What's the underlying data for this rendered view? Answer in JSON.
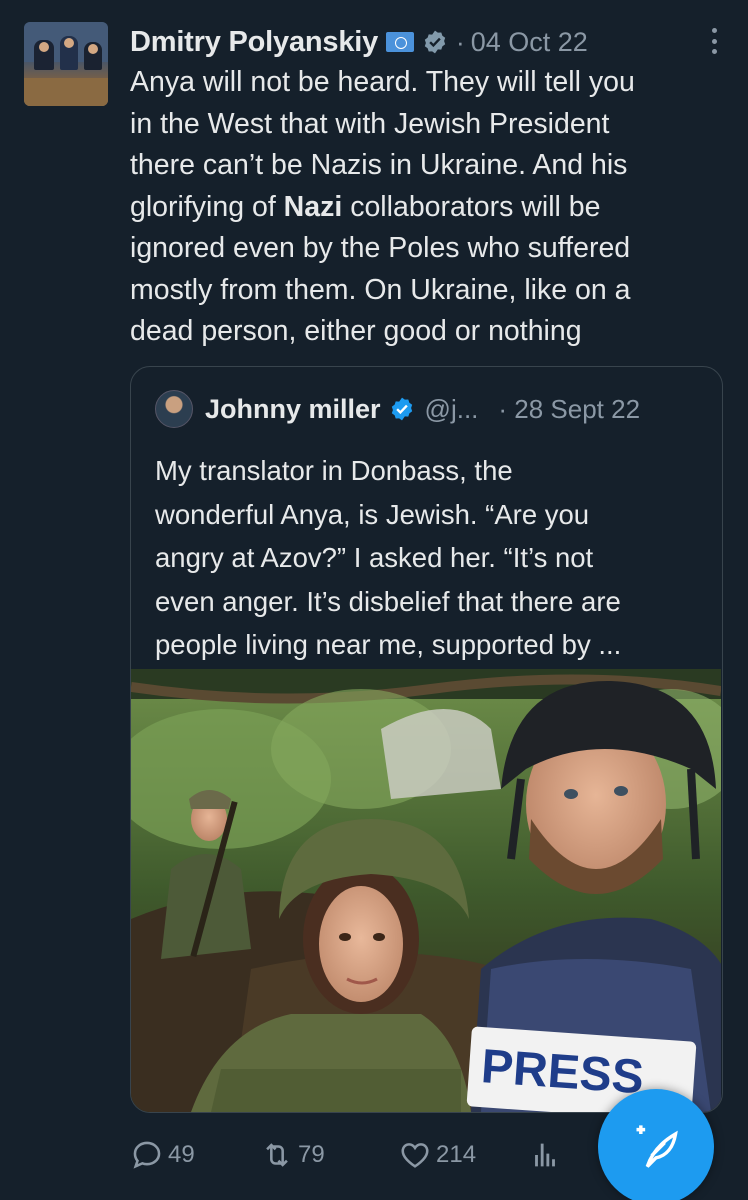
{
  "post": {
    "author_name": "Dmitry Polyanskiy",
    "date": "04 Oct 22",
    "separator": "·",
    "text_lines": [
      "Anya will not be heard. They will tell you",
      "in the West that with Jewish President",
      "there can’t be Nazis in Ukraine. And his",
      {
        "before": "glorifying of ",
        "bold": "Nazi",
        "after": " collaborators will be"
      },
      "ignored even by the Poles who suffered",
      "mostly from them. On Ukraine, like on a",
      "dead person, either good or nothing"
    ]
  },
  "quote": {
    "author_name": "Johnny miller",
    "handle": "@j...",
    "date": "· 28 Sept 22",
    "text_lines": [
      "My translator in Donbass, the",
      "wonderful Anya, is Jewish. “Are you",
      "angry at Azov?” I asked her. “It’s not",
      "even anger. It’s disbelief that there are",
      "people living near me, supported by ..."
    ],
    "image_press_text": "PRESS"
  },
  "actions": {
    "replies": "49",
    "reposts": "79",
    "likes": "214"
  },
  "icons": {
    "more": "more-vertical-icon",
    "reply": "reply-icon",
    "repost": "repost-icon",
    "like": "heart-icon",
    "views": "views-icon",
    "compose": "compose-feather-icon",
    "verified": "verified-badge-icon",
    "government": "government-badge-icon",
    "flag": "un-flag-icon"
  },
  "colors": {
    "background": "#15202b",
    "text": "#e7e9ea",
    "muted": "#8b98a5",
    "accent": "#1d9bf0",
    "border": "#38444d"
  }
}
